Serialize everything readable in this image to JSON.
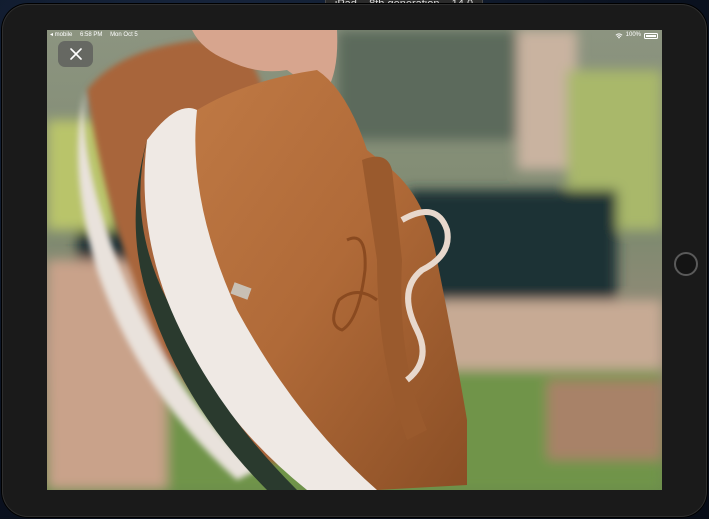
{
  "simulator": {
    "window_title": "iPad – 8th generation – 14.0"
  },
  "status_bar": {
    "back_app": "◂ mobile",
    "time": "6:58 PM",
    "date": "Mon Oct 5",
    "battery": "100%",
    "battery_level": 1.0
  },
  "viewer": {
    "close_icon": "close-icon",
    "image_subject": "tan leather sneaker with white sole held in hand"
  }
}
